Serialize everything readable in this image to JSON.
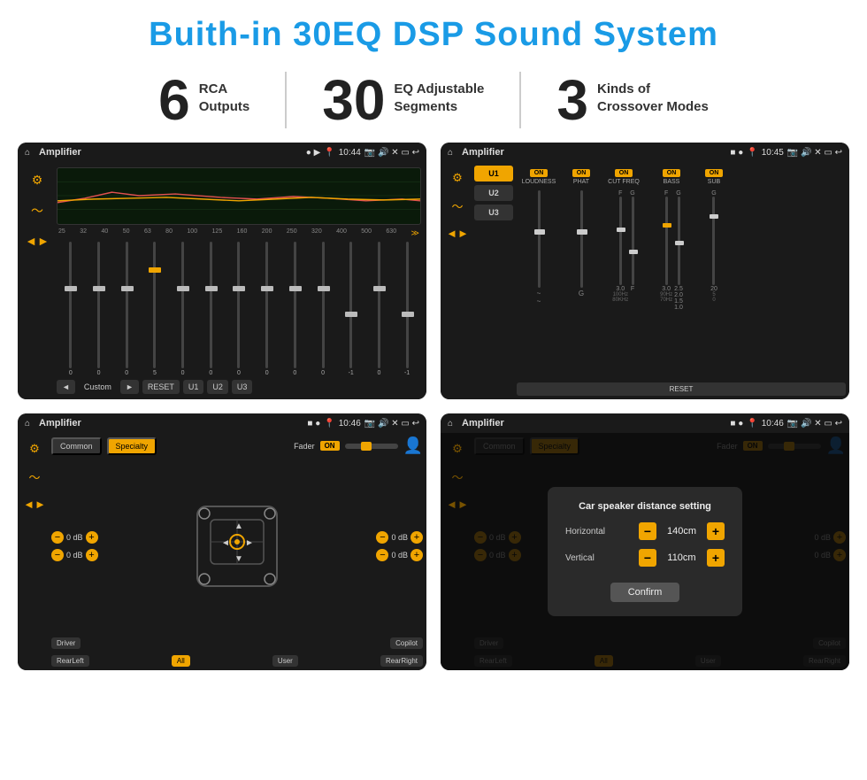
{
  "page": {
    "title": "Buith-in 30EQ DSP Sound System",
    "stats": [
      {
        "number": "6",
        "label_line1": "RCA",
        "label_line2": "Outputs"
      },
      {
        "number": "30",
        "label_line1": "EQ Adjustable",
        "label_line2": "Segments"
      },
      {
        "number": "3",
        "label_line1": "Kinds of",
        "label_line2": "Crossover Modes"
      }
    ],
    "screens": [
      {
        "id": "eq-screen",
        "status_bar": {
          "time": "10:44",
          "title": "Amplifier"
        },
        "type": "equalizer",
        "freq_labels": [
          "25",
          "32",
          "40",
          "50",
          "63",
          "80",
          "100",
          "125",
          "160",
          "200",
          "250",
          "320",
          "400",
          "500",
          "630"
        ],
        "slider_values": [
          "0",
          "0",
          "0",
          "5",
          "0",
          "0",
          "0",
          "0",
          "0",
          "0",
          "-1",
          "0",
          "-1"
        ],
        "bottom_buttons": [
          "Custom",
          "RESET",
          "U1",
          "U2",
          "U3"
        ]
      },
      {
        "id": "amp-screen",
        "status_bar": {
          "time": "10:45",
          "title": "Amplifier"
        },
        "type": "amplifier",
        "presets": [
          "U1",
          "U2",
          "U3"
        ],
        "controls": [
          "LOUDNESS",
          "PHAT",
          "CUT FREQ",
          "BASS",
          "SUB"
        ],
        "reset_label": "RESET"
      },
      {
        "id": "speaker-screen",
        "status_bar": {
          "time": "10:46",
          "title": "Amplifier"
        },
        "type": "speaker",
        "tabs": [
          "Common",
          "Specialty"
        ],
        "fader_label": "Fader",
        "fader_on": "ON",
        "positions": {
          "top_left": "0 dB",
          "top_right": "0 dB",
          "bottom_left": "0 dB",
          "bottom_right": "0 dB"
        },
        "bottom_labels": [
          "Driver",
          "",
          "Copilot",
          "RearLeft",
          "All",
          "User",
          "RearRight"
        ]
      },
      {
        "id": "dist-screen",
        "status_bar": {
          "time": "10:46",
          "title": "Amplifier"
        },
        "type": "distance",
        "tabs": [
          "Common",
          "Specialty"
        ],
        "dialog": {
          "title": "Car speaker distance setting",
          "horizontal_label": "Horizontal",
          "horizontal_value": "140cm",
          "vertical_label": "Vertical",
          "vertical_value": "110cm",
          "confirm_label": "Confirm"
        },
        "right_values": [
          "0 dB",
          "0 dB"
        ],
        "bottom_labels": [
          "Driver",
          "Copilot",
          "RearLeft",
          "All",
          "User",
          "RearRight"
        ]
      }
    ]
  }
}
